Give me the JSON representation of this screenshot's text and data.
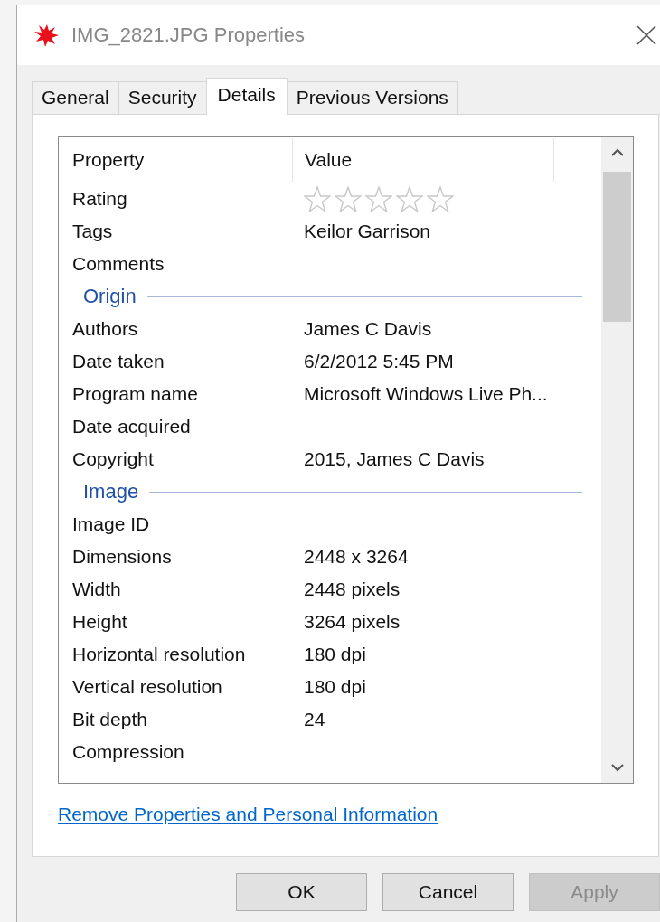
{
  "window": {
    "title": "IMG_2821.JPG Properties"
  },
  "tabs": [
    {
      "label": "General",
      "selected": false
    },
    {
      "label": "Security",
      "selected": false
    },
    {
      "label": "Details",
      "selected": true
    },
    {
      "label": "Previous Versions",
      "selected": false
    }
  ],
  "table": {
    "columns": [
      "Property",
      "Value"
    ],
    "rows": [
      {
        "kind": "stars",
        "property": "Rating",
        "stars": 0
      },
      {
        "kind": "row",
        "property": "Tags",
        "value": "Keilor Garrison"
      },
      {
        "kind": "row",
        "property": "Comments"
      },
      {
        "kind": "section",
        "property": "Origin"
      },
      {
        "kind": "row",
        "property": "Authors",
        "value": "James C Davis"
      },
      {
        "kind": "row",
        "property": "Date taken",
        "value": "6/2/2012 5:45 PM"
      },
      {
        "kind": "row",
        "property": "Program name",
        "value": "Microsoft Windows Live Ph..."
      },
      {
        "kind": "row",
        "property": "Date acquired"
      },
      {
        "kind": "row",
        "property": "Copyright",
        "value": "2015, James C Davis"
      },
      {
        "kind": "section",
        "property": "Image"
      },
      {
        "kind": "row",
        "property": "Image ID"
      },
      {
        "kind": "row",
        "property": "Dimensions",
        "value": "2448 x 3264"
      },
      {
        "kind": "row",
        "property": "Width",
        "value": "2448 pixels"
      },
      {
        "kind": "row",
        "property": "Height",
        "value": "3264 pixels"
      },
      {
        "kind": "row",
        "property": "Horizontal resolution",
        "value": "180 dpi"
      },
      {
        "kind": "row",
        "property": "Vertical resolution",
        "value": "180 dpi"
      },
      {
        "kind": "row",
        "property": "Bit depth",
        "value": "24"
      },
      {
        "kind": "row",
        "property": "Compression"
      }
    ]
  },
  "link": "Remove Properties and Personal Information",
  "buttons": [
    {
      "label": "OK",
      "disabled": false
    },
    {
      "label": "Cancel",
      "disabled": false
    },
    {
      "label": "Apply",
      "disabled": true
    }
  ]
}
